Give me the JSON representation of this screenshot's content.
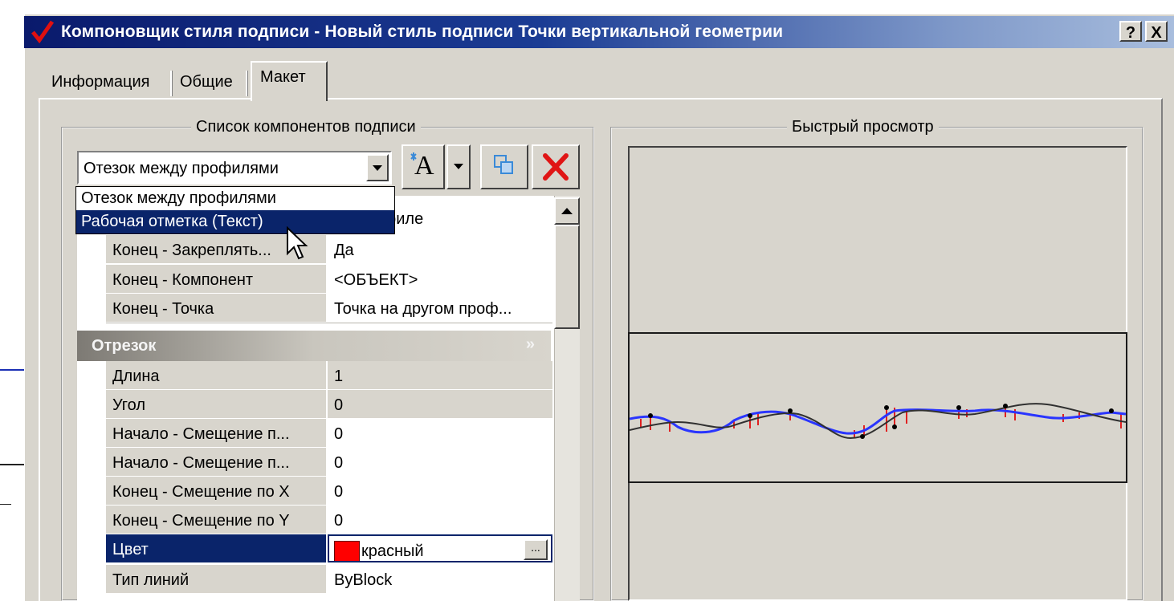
{
  "window": {
    "title": "Компоновщик стиля подписи - Новый стиль подписи Точки вертикальной геометрии",
    "help_button": "?",
    "close_button": "X"
  },
  "tabs": [
    {
      "label": "Информация",
      "active": false
    },
    {
      "label": "Общие",
      "active": false
    },
    {
      "label": "Макет",
      "active": true
    }
  ],
  "components": {
    "group_title": "Список компонентов подписи",
    "selected": "Отезок между профилями",
    "dropdown_options": [
      {
        "label": "Отезок между профилями",
        "highlighted": false
      },
      {
        "label": "Рабочая отметка (Текст)",
        "highlighted": true
      }
    ],
    "text_tool_glyph": "A"
  },
  "properties": {
    "rows_top": [
      {
        "name": "",
        "value": "на профиле"
      },
      {
        "name": "Конец - Закреплять...",
        "value": "Да"
      },
      {
        "name": "Конец - Компонент",
        "value": "<ОБЪЕКТ>"
      },
      {
        "name": "Конец - Точка",
        "value": "Точка на другом проф..."
      }
    ],
    "section": "Отрезок",
    "section_chevron": "»",
    "rows": [
      {
        "name": "Длина",
        "value": "1"
      },
      {
        "name": "Угол",
        "value": "0"
      },
      {
        "name": "Начало - Смещение п...",
        "value": "0"
      },
      {
        "name": "Начало - Смещение п...",
        "value": "0"
      },
      {
        "name": "Конец - Смещение по X",
        "value": "0"
      },
      {
        "name": "Конец - Смещение по Y",
        "value": "0"
      }
    ],
    "color_row": {
      "name": "Цвет",
      "value": "красный",
      "swatch": "#ff0000",
      "browse": "..."
    },
    "last_row": {
      "name": "Тип линий",
      "value": "ByBlock"
    }
  },
  "preview": {
    "group_title": "Быстрый просмотр"
  },
  "colors": {
    "accent": "#0a246a",
    "face": "#d8d5cd",
    "profile_line_1": "#2a35ff",
    "profile_line_2": "#303030",
    "hatch": "#e02020"
  }
}
